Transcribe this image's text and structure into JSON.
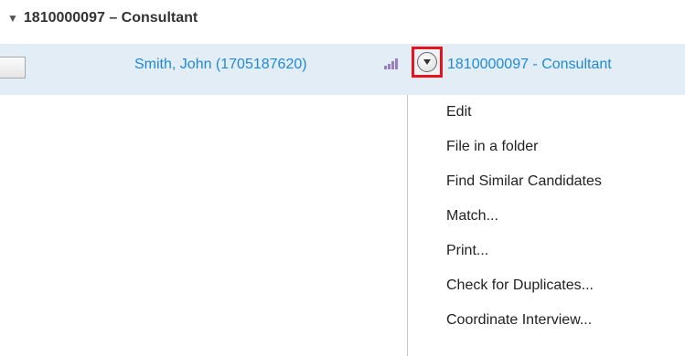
{
  "section": {
    "expand_glyph": "▼",
    "title": "1810000097 – Consultant"
  },
  "row": {
    "candidate_link": "Smith, John (1705187620)",
    "ranking_icon": "bar-chart-icon",
    "menu_toggle_icon": "chevron-down-circle-icon",
    "requisition_link": "1810000097 - Consultant"
  },
  "context_menu": {
    "items": [
      {
        "label": "Edit"
      },
      {
        "label": "File in a folder"
      },
      {
        "label": "Find Similar Candidates"
      },
      {
        "label": "Match..."
      },
      {
        "label": "Print..."
      },
      {
        "label": "Check for Duplicates..."
      },
      {
        "label": "Coordinate Interview..."
      }
    ]
  },
  "colors": {
    "link": "#1e8ad6",
    "row_highlight": "#e3edf6",
    "highlight_box": "#e8141c",
    "ranking_icon": "#9b7fc4"
  }
}
